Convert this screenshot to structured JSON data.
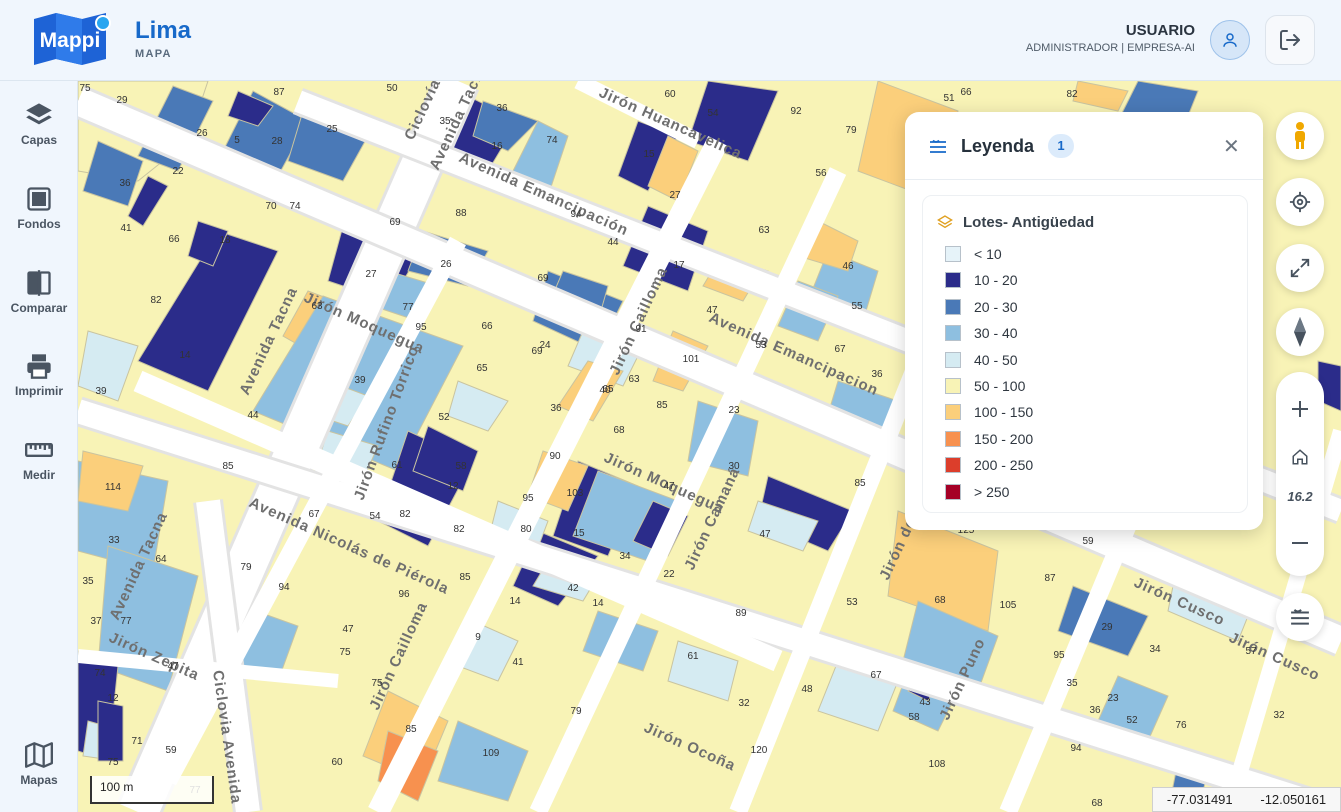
{
  "header": {
    "logo_text": "Mappi",
    "title": "Lima",
    "subtitle": "MAPA",
    "user_name": "USUARIO",
    "user_role": "ADMINISTRADOR | EMPRESA-AI"
  },
  "sidebar": {
    "items": [
      {
        "label": "Capas",
        "icon": "layers-icon"
      },
      {
        "label": "Fondos",
        "icon": "grid-icon"
      },
      {
        "label": "Comparar",
        "icon": "compare-icon"
      },
      {
        "label": "Imprimir",
        "icon": "printer-icon"
      },
      {
        "label": "Medir",
        "icon": "ruler-icon"
      },
      {
        "label": "Mapas",
        "icon": "map-icon"
      }
    ]
  },
  "legend": {
    "title": "Leyenda",
    "count": "1",
    "layer_name": "Lotes- Antigüedad",
    "classes": [
      {
        "label": "< 10",
        "color": "#e6f3f9"
      },
      {
        "label": "10 - 20",
        "color": "#2b2c8a"
      },
      {
        "label": "20 - 30",
        "color": "#4a79b7"
      },
      {
        "label": "30 - 40",
        "color": "#8ebfe0"
      },
      {
        "label": "40 - 50",
        "color": "#d5ebf2"
      },
      {
        "label": "50 - 100",
        "color": "#f8f3b6"
      },
      {
        "label": "100 - 150",
        "color": "#fbcf7b"
      },
      {
        "label": "150 - 200",
        "color": "#f7914f"
      },
      {
        "label": "200 - 250",
        "color": "#dc3e2b"
      },
      {
        "label": "> 250",
        "color": "#a50026"
      }
    ]
  },
  "controls": {
    "zoom_level": "16.2"
  },
  "scale": "100 m",
  "coordinates": {
    "lon": "-77.031491",
    "lat": "-12.050161"
  },
  "map": {
    "streets": [
      "Avenida Tacna",
      "Avenida Emancipación",
      "Avenida Emancipacion",
      "Avenida Nicolás de Piérola",
      "Jirón Moquegua",
      "Jirón Camaná",
      "Jirón Cailloma",
      "Jirón Huancavelica",
      "Jirón Ocoña",
      "Jirón Zepita",
      "Jirón Cusco",
      "Jirón Puno",
      "Ciclovía",
      "Ciclovia Avenida",
      "Jirón de la Unión",
      "Jirón Rufino Torrico"
    ],
    "lot_labels": [
      "75",
      "29",
      "87",
      "50",
      "60",
      "35",
      "36",
      "54",
      "92",
      "79",
      "66",
      "82",
      "51",
      "26",
      "28",
      "25",
      "5",
      "15",
      "16",
      "74",
      "70",
      "22",
      "36",
      "41",
      "74",
      "27",
      "56",
      "94",
      "63",
      "88",
      "69",
      "44",
      "17",
      "66",
      "18",
      "26",
      "46",
      "63",
      "82",
      "27",
      "77",
      "69",
      "47",
      "55",
      "39",
      "14",
      "95",
      "66",
      "69",
      "24",
      "91",
      "53",
      "67",
      "36",
      "63",
      "39",
      "65",
      "101",
      "36",
      "40",
      "85",
      "44",
      "52",
      "68",
      "23",
      "65",
      "85",
      "61",
      "58",
      "90",
      "12",
      "47",
      "30",
      "114",
      "67",
      "54",
      "82",
      "95",
      "103",
      "80",
      "15",
      "14",
      "85",
      "47",
      "82",
      "85",
      "42",
      "34",
      "22",
      "14",
      "33",
      "64",
      "79",
      "96",
      "9",
      "125",
      "59",
      "87",
      "35",
      "77",
      "94",
      "47",
      "89",
      "53",
      "68",
      "105",
      "29",
      "34",
      "37",
      "47",
      "75",
      "41",
      "61",
      "95",
      "35",
      "57",
      "75",
      "12",
      "75",
      "79",
      "85",
      "109",
      "32",
      "48",
      "67",
      "58",
      "43",
      "23",
      "36",
      "52",
      "76",
      "32",
      "74",
      "59",
      "71",
      "77",
      "60",
      "68",
      "120",
      "94",
      "108"
    ]
  }
}
